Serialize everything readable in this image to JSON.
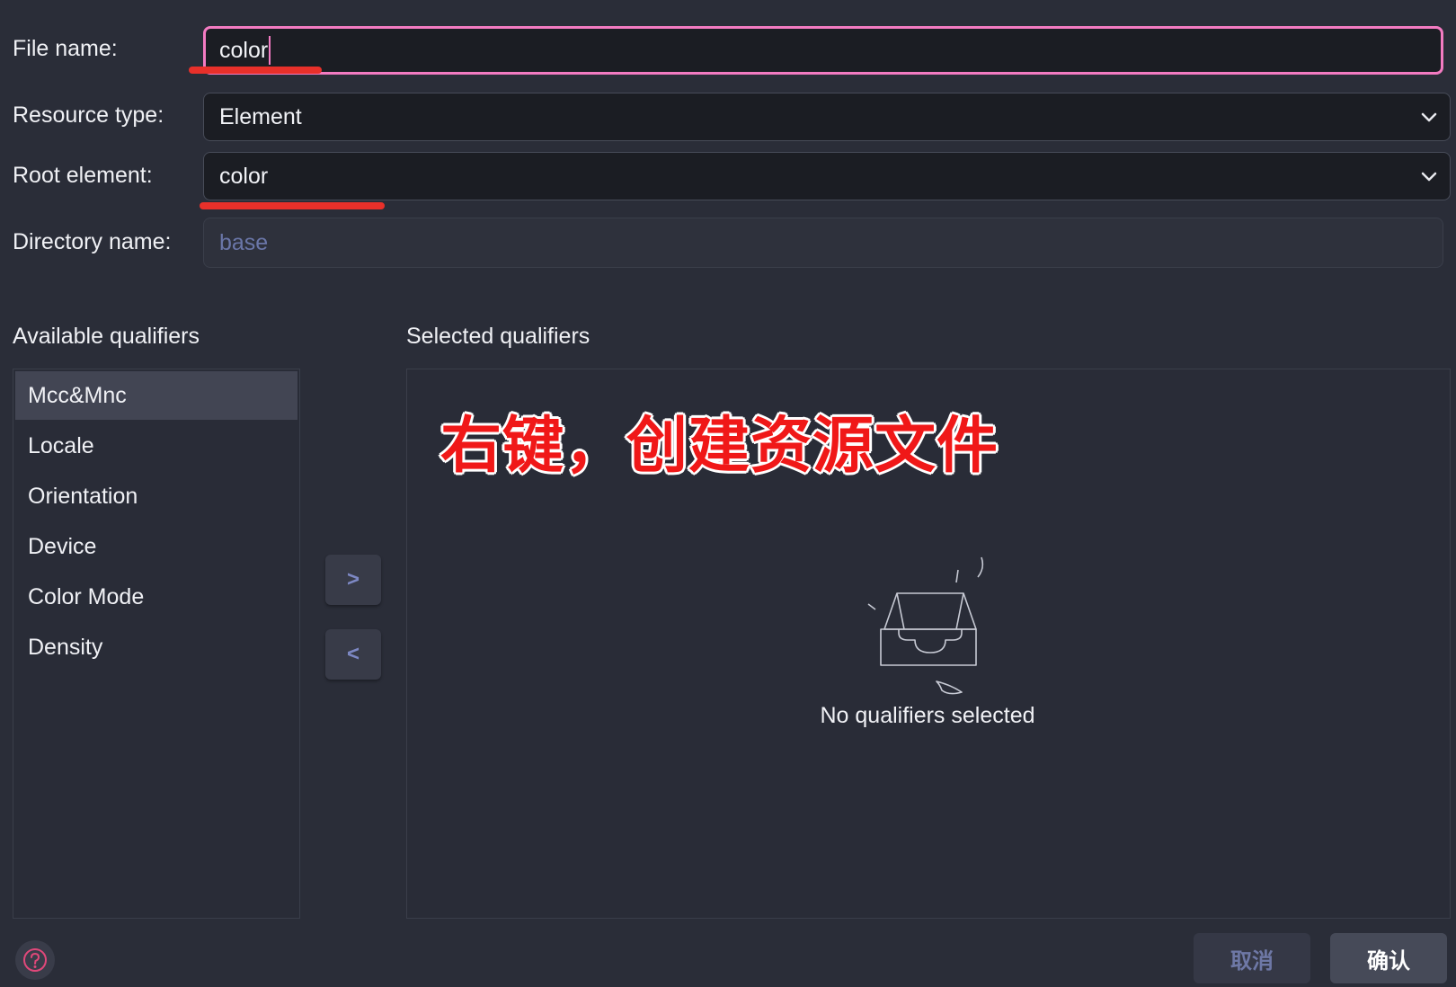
{
  "form": {
    "file_name_label": "File name:",
    "file_name_value": "color",
    "resource_type_label": "Resource type:",
    "resource_type_value": "Element",
    "root_element_label": "Root element:",
    "root_element_value": "color",
    "directory_name_label": "Directory name:",
    "directory_name_value": "base"
  },
  "qualifiers": {
    "available_title": "Available qualifiers",
    "selected_title": "Selected qualifiers",
    "items": [
      "Mcc&Mnc",
      "Locale",
      "Orientation",
      "Device",
      "Color Mode",
      "Density"
    ],
    "selected_item": "Mcc&Mnc",
    "add_label": ">",
    "remove_label": "<",
    "empty_text": "No qualifiers selected"
  },
  "annotation": "右键，创建资源文件",
  "buttons": {
    "cancel": "取消",
    "confirm": "确认"
  },
  "icons": {
    "help": "help-icon",
    "empty": "empty-inbox-icon",
    "dropdown": "chevron-down-icon"
  },
  "colors": {
    "focus_border": "#f37bc2",
    "annotation": "#f01818",
    "underline": "#e8302a"
  }
}
